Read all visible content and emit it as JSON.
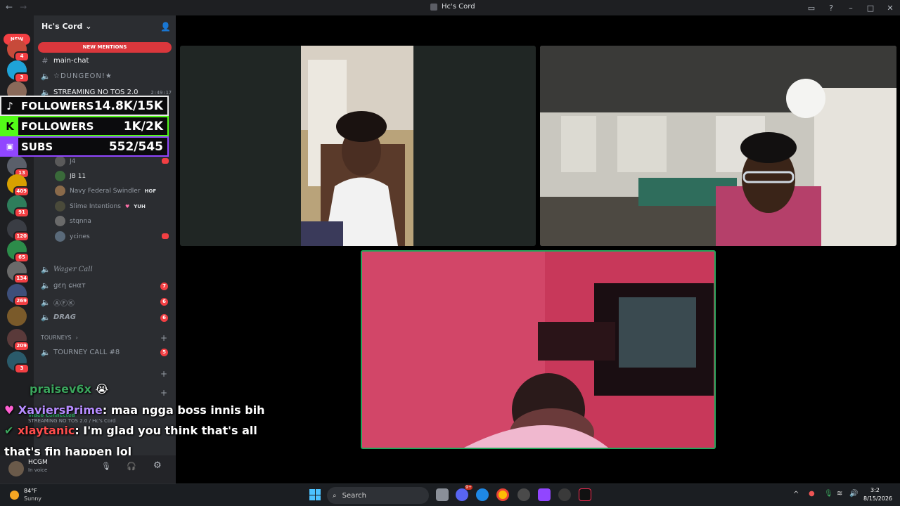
{
  "window": {
    "title": "Hc's Cord"
  },
  "rail": {
    "new_label": "NEW",
    "badges": [
      "4",
      "3",
      "13",
      "409",
      "91",
      "120",
      "65",
      "134",
      "269",
      "209",
      "3"
    ]
  },
  "sidebar": {
    "guild_name": "Hc's Cord",
    "new_mentions": "NEW MENTIONS",
    "channels": {
      "main_chat": "main-chat",
      "dungeon": "☆DUNGEON!★",
      "streaming": "STREAMING NO TOS 2.0",
      "streaming_timer": "2:49:17",
      "wager_call": "Wager Call",
      "gen_chat": "ցεη ɕнαт",
      "afk": "ⒶⒻⓀ",
      "drag": "DRAG",
      "tourneys": "TOURNEYS",
      "tourney_call": "TOURNEY CALL #8"
    },
    "channel_badges": {
      "gen_chat": "7",
      "afk": "6",
      "drag": "6",
      "tourney_call": "5"
    },
    "voice_users": {
      "j4": "J4",
      "jb11": "JB 11",
      "navy": "Navy Federal Swindler",
      "navy_tag": "HOF",
      "slime": "Slime Intentions",
      "slime_tag": "YUH",
      "stqnna": "stqnna",
      "ycines": "ycines"
    }
  },
  "overlay": {
    "tiktok": {
      "label": "FOLLOWERS",
      "value": "14.8K/15K",
      "color": "#e8e8e8"
    },
    "kick": {
      "label": "FOLLOWERS",
      "value": "1K/2K",
      "color": "#53fc18"
    },
    "twitch": {
      "label": "SUBS",
      "value": "552/545",
      "color": "#9146ff"
    }
  },
  "chat": [
    {
      "user": "praisev6x",
      "text": " 😭",
      "color": "#3ba55d"
    },
    {
      "user": "XaviersPrime",
      "text": ": maa ngga boss innis bih",
      "color": "#b68cff"
    },
    {
      "user": "xlaytanic",
      "text": ": I'm glad you think that's all",
      "color": "#ff4d4d"
    },
    {
      "user": "",
      "text": "that's fin happen lol",
      "color": "#ffffff"
    }
  ],
  "voice_status": {
    "title": "Video Connected",
    "subtitle": "STREAMING NO TOS 2.0 / Hc's Cord",
    "username": "HCGM",
    "status": "In voice"
  },
  "taskbar": {
    "weather_temp": "84°F",
    "weather_desc": "Sunny",
    "search": "Search",
    "time": "3:2",
    "date": "8/15/2026",
    "discord_badge": "9+"
  },
  "colors": {
    "accent": "#5865f2",
    "danger": "#f23f43",
    "sidebar": "#2b2d31",
    "rail": "#1e1f22"
  }
}
